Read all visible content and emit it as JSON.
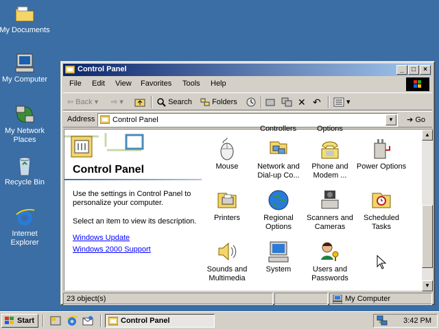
{
  "desktop": {
    "icons": [
      {
        "label": "My Documents"
      },
      {
        "label": "My Computer"
      },
      {
        "label": "My Network Places"
      },
      {
        "label": "Recycle Bin"
      },
      {
        "label": "Internet Explorer"
      }
    ]
  },
  "window": {
    "title": "Control Panel",
    "menu": [
      "File",
      "Edit",
      "View",
      "Favorites",
      "Tools",
      "Help"
    ],
    "toolbar": {
      "back": "Back",
      "search": "Search",
      "folders": "Folders"
    },
    "address": {
      "label": "Address",
      "value": "Control Panel",
      "go": "Go"
    },
    "left_pane": {
      "title": "Control Panel",
      "desc1": "Use the settings in Control Panel to personalize your computer.",
      "desc2": "Select an item to view its description.",
      "links": [
        "Windows Update",
        "Windows 2000 Support"
      ]
    },
    "partial_labels": [
      "Controllers",
      "Options"
    ],
    "items": [
      {
        "label": "Mouse"
      },
      {
        "label": "Network and Dial-up Co..."
      },
      {
        "label": "Phone and Modem ..."
      },
      {
        "label": "Power Options"
      },
      {
        "label": "Printers"
      },
      {
        "label": "Regional Options"
      },
      {
        "label": "Scanners and Cameras"
      },
      {
        "label": "Scheduled Tasks"
      },
      {
        "label": "Sounds and Multimedia"
      },
      {
        "label": "System"
      },
      {
        "label": "Users and Passwords"
      }
    ],
    "status": {
      "count": "23 object(s)",
      "zone": "My Computer"
    }
  },
  "taskbar": {
    "start": "Start",
    "task": "Control Panel",
    "clock": "3:42 PM"
  }
}
